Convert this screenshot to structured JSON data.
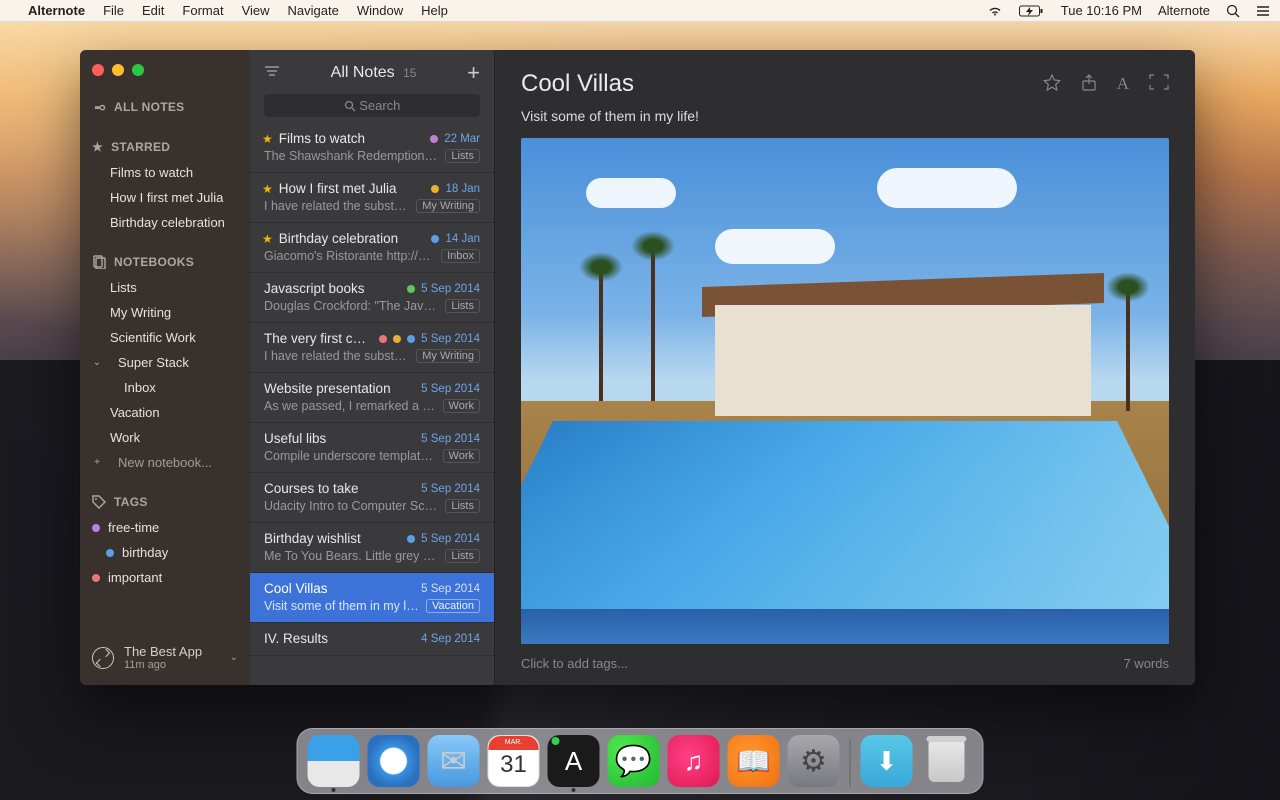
{
  "menubar": {
    "app": "Alternote",
    "items": [
      "File",
      "Edit",
      "Format",
      "View",
      "Navigate",
      "Window",
      "Help"
    ],
    "clock": "Tue 10:16 PM",
    "right_app": "Alternote"
  },
  "sidebar": {
    "all_notes": "ALL NOTES",
    "starred_head": "STARRED",
    "starred": [
      "Films to watch",
      "How I first met Julia",
      "Birthday celebration"
    ],
    "notebooks_head": "NOTEBOOKS",
    "notebooks": [
      "Lists",
      "My Writing",
      "Scientific Work",
      "Super Stack"
    ],
    "super_sub": [
      "Inbox"
    ],
    "more_nb": [
      "Vacation",
      "Work"
    ],
    "new_nb": "New notebook...",
    "tags_head": "TAGS",
    "tags": [
      {
        "label": "free-time",
        "color": "#b980e8"
      },
      {
        "label": "birthday",
        "color": "#5aa0e8"
      },
      {
        "label": "important",
        "color": "#e87878"
      }
    ],
    "sync": {
      "title": "The Best App",
      "time": "11m ago"
    }
  },
  "notelist": {
    "title": "All Notes",
    "count": "15",
    "search": "Search",
    "notes": [
      {
        "star": true,
        "title": "Films to watch",
        "dot": "#c080d8",
        "date": "22 Mar",
        "snip": "The Shawshank Redemption (1…",
        "nb": "Lists"
      },
      {
        "star": true,
        "title": "How I first met Julia",
        "dot": "#e8b030",
        "date": "18 Jan",
        "snip": "I have related the substan…",
        "nb": "My Writing"
      },
      {
        "star": true,
        "title": "Birthday celebration",
        "dot": "#5aa0e8",
        "date": "14 Jan",
        "snip": "Giacomo's Ristorante http://w…",
        "nb": "Inbox"
      },
      {
        "star": false,
        "title": "Javascript books",
        "dot": "#60c860",
        "date": "5 Sep 2014",
        "snip": "Douglas Crockford: \"The JavaS…",
        "nb": "Lists"
      },
      {
        "star": false,
        "title": "The very first cha…",
        "dot": "multi",
        "date": "5 Sep 2014",
        "snip": "I have related the substan…",
        "nb": "My Writing"
      },
      {
        "star": false,
        "title": "Website presentation",
        "dot": "",
        "date": "5 Sep 2014",
        "snip": "As we passed, I remarked a be…",
        "nb": "Work"
      },
      {
        "star": false,
        "title": "Useful libs",
        "dot": "",
        "date": "5 Sep 2014",
        "snip": "Compile underscore templates…",
        "nb": "Work"
      },
      {
        "star": false,
        "title": "Courses to take",
        "dot": "",
        "date": "5 Sep 2014",
        "snip": "Udacity Intro to Computer Scie…",
        "nb": "Lists"
      },
      {
        "star": false,
        "title": "Birthday wishlist",
        "dot": "#5aa0e8",
        "date": "5 Sep 2014",
        "snip": "Me To You Bears. Little grey ba…",
        "nb": "Lists"
      },
      {
        "star": false,
        "title": "Cool Villas",
        "dot": "",
        "date": "5 Sep 2014",
        "snip": "Visit some of them in my life!",
        "nb": "Vacation",
        "selected": true
      },
      {
        "star": false,
        "title": "IV. Results",
        "dot": "",
        "date": "4 Sep 2014",
        "snip": "",
        "nb": ""
      }
    ]
  },
  "editor": {
    "title": "Cool Villas",
    "body": "Visit some of them in my life!",
    "tags_placeholder": "Click to add tags...",
    "words": "7 words"
  },
  "dock": {
    "cal_month": "MAR.",
    "cal_day": "31"
  }
}
